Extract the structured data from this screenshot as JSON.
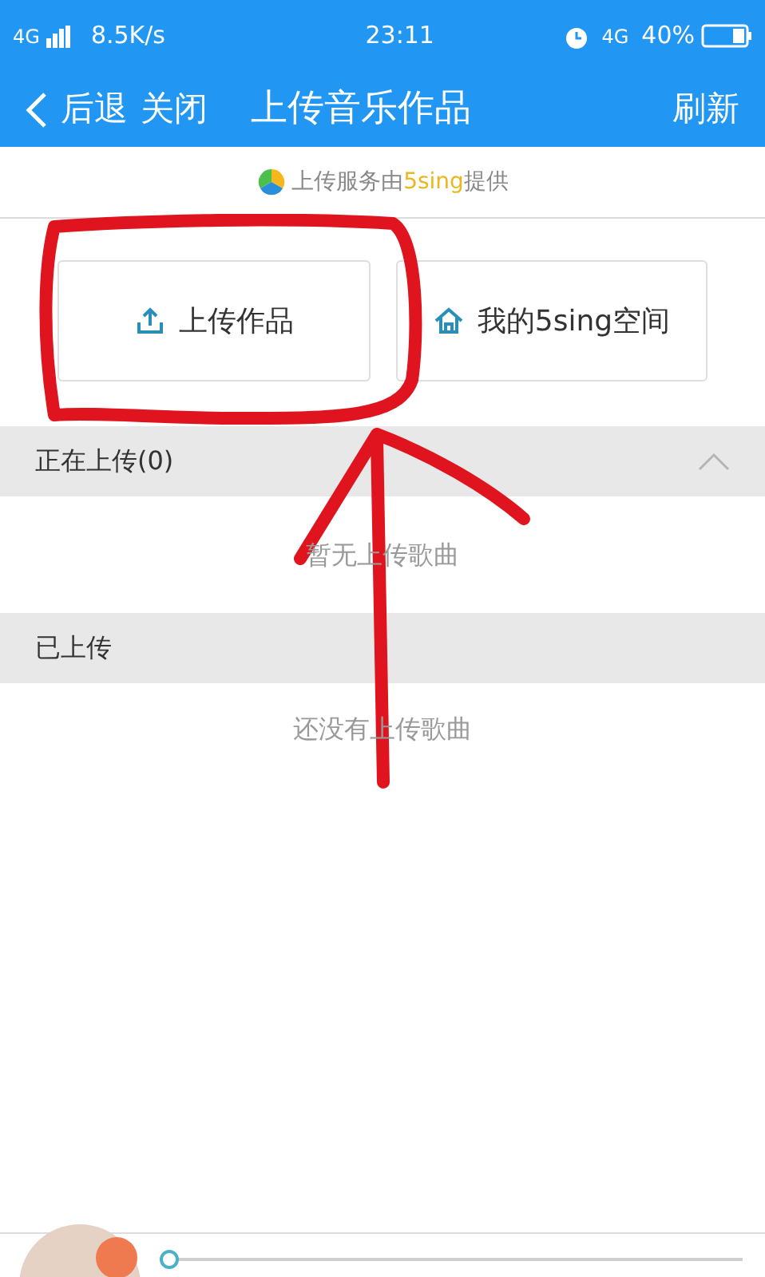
{
  "status_bar": {
    "network": "4G",
    "speed": "8.5K/s",
    "time": "23:11",
    "network_right": "4G",
    "battery": "40%"
  },
  "header": {
    "back": "后退",
    "close": "关闭",
    "title": "上传音乐作品",
    "refresh": "刷新"
  },
  "banner": {
    "text": "上传服务由**5sing**提供"
  },
  "actions": [
    {
      "kind": "upload",
      "label": "上传作品"
    },
    {
      "kind": "home",
      "label": "我的5sing空间"
    }
  ],
  "sections": [
    {
      "title": "正在上传(0)",
      "collapsible": true,
      "empty_text": "暂无上传歌曲"
    },
    {
      "title": "已上传",
      "collapsible": false,
      "empty_text": "还没有上传歌曲"
    }
  ],
  "player": {
    "level": 0
  }
}
